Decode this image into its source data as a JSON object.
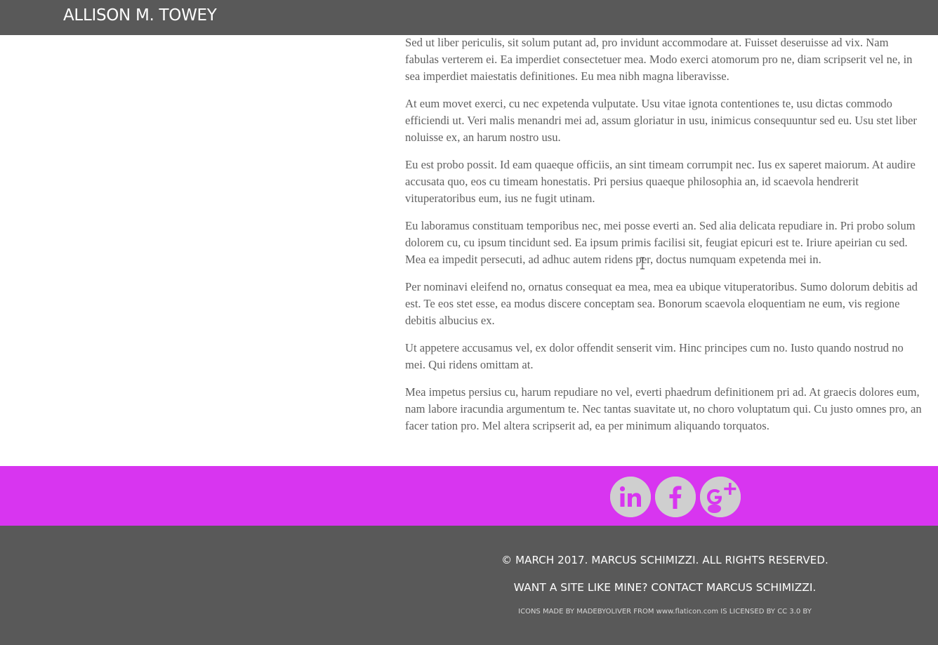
{
  "header": {
    "title": "ALLISON M. TOWEY"
  },
  "main": {
    "paragraphs": [
      "Sed ut liber periculis, sit solum putant ad, pro invidunt accommodare at. Fuisset deseruisse ad vix. Nam fabulas verterem ei. Ea imperdiet consectetuer mea. Modo exerci atomorum pro ne, diam scripserit vel ne, in sea imperdiet maiestatis definitiones. Eu mea nibh magna liberavisse.",
      "At eum movet exerci, cu nec expetenda vulputate. Usu vitae ignota contentiones te, usu dictas commodo efficiendi ut. Veri malis menandri mei ad, assum gloriatur in usu, inimicus consequuntur sed eu. Usu stet liber noluisse ex, an harum nostro usu.",
      "Eu est probo possit. Id eam quaeque officiis, an sint timeam corrumpit nec. Ius ex saperet maiorum. At audire accusata quo, eos cu timeam honestatis. Pri persius quaeque philosophia an, id scaevola hendrerit vituperatoribus eum, ius ne fugit utinam.",
      "Eu laboramus constituam temporibus nec, mei posse everti an. Sed alia delicata repudiare in. Pri probo solum dolorem cu, cu ipsum tincidunt sed. Ea ipsum primis facilisi sit, feugiat epicuri est te. Iriure apeirian cu sed. Mea ea impedit persecuti, ad adhuc autem ridens per, doctus numquam expetenda mei in.",
      "Per nominavi eleifend no, ornatus consequat ea mea, mea ea ubique vituperatoribus. Sumo dolorum debitis ad est. Te eos stet esse, ea modus discere conceptam sea. Bonorum scaevola eloquentiam ne eum, vis regione debitis albucius ex.",
      "Ut appetere accusamus vel, ex dolor offendit senserit vim. Hinc principes cum no. Iusto quando nostrud no mei. Qui ridens omittam at.",
      "Mea impetus persius cu, harum repudiare no vel, everti phaedrum definitionem pri ad. At graecis dolores eum, nam labore iracundia argumentum te. Nec tantas suavitate ut, no choro voluptatum qui. Cu justo omnes pro, an facer tation pro. Mel altera scripserit ad, ea per minimum aliquando torquatos."
    ]
  },
  "social": {
    "items": [
      {
        "icon": "linkedin-icon",
        "label": "in"
      },
      {
        "icon": "facebook-icon",
        "label": "f"
      },
      {
        "icon": "google-plus-icon",
        "label": "g+"
      }
    ]
  },
  "footer": {
    "copyright": "© MARCH 2017. MARCUS SCHIMIZZI. ALL RIGHTS RESERVED.",
    "contact_prefix": "WANT A SITE LIKE MINE? ",
    "contact_link": "CONTACT MARCUS SCHIMIZZI.",
    "credits": {
      "prefix": "ICONS MADE BY ",
      "author": "MADEBYOLIVER",
      "middle": " FROM ",
      "site": "www.flaticon.com",
      "middle2": " IS LICENSED BY ",
      "license": "CC 3.0 BY"
    }
  },
  "colors": {
    "header_bg": "#595959",
    "social_band": "#d835f0",
    "icon_circle": "#cfcfcf",
    "body_text": "#606060"
  }
}
